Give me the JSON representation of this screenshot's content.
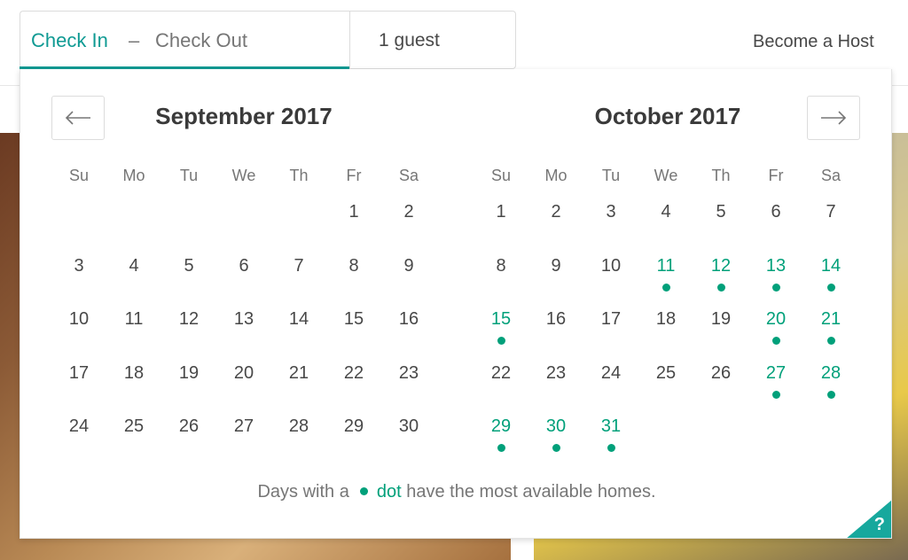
{
  "header": {
    "check_in_label": "Check In",
    "dash": "–",
    "check_out_label": "Check Out",
    "guests_label": "1 guest",
    "become_host_label": "Become a Host"
  },
  "colors": {
    "accent": "#0f9a93",
    "available": "#00a07a",
    "help_corner": "#17a89d"
  },
  "calendar": {
    "prev_icon": "arrow-left-icon",
    "next_icon": "arrow-right-icon",
    "weekdays": [
      "Su",
      "Mo",
      "Tu",
      "We",
      "Th",
      "Fr",
      "Sa"
    ],
    "months": [
      {
        "title": "September 2017",
        "weeks": [
          [
            "",
            "",
            "",
            "",
            "",
            "1",
            "2"
          ],
          [
            "3",
            "4",
            "5",
            "6",
            "7",
            "8",
            "9"
          ],
          [
            "10",
            "11",
            "12",
            "13",
            "14",
            "15",
            "16"
          ],
          [
            "17",
            "18",
            "19",
            "20",
            "21",
            "22",
            "23"
          ],
          [
            "24",
            "25",
            "26",
            "27",
            "28",
            "29",
            "30"
          ]
        ],
        "available_days": []
      },
      {
        "title": "October 2017",
        "weeks": [
          [
            "1",
            "2",
            "3",
            "4",
            "5",
            "6",
            "7"
          ],
          [
            "8",
            "9",
            "10",
            "11",
            "12",
            "13",
            "14"
          ],
          [
            "15",
            "16",
            "17",
            "18",
            "19",
            "20",
            "21"
          ],
          [
            "22",
            "23",
            "24",
            "25",
            "26",
            "27",
            "28"
          ],
          [
            "29",
            "30",
            "31",
            "",
            "",
            "",
            ""
          ]
        ],
        "available_days": [
          "11",
          "12",
          "13",
          "14",
          "15",
          "20",
          "21",
          "27",
          "28",
          "29",
          "30",
          "31"
        ]
      }
    ],
    "legend_prefix": "Days with a",
    "legend_accent": "dot",
    "legend_suffix": "have the most available homes.",
    "help_label": "?"
  }
}
